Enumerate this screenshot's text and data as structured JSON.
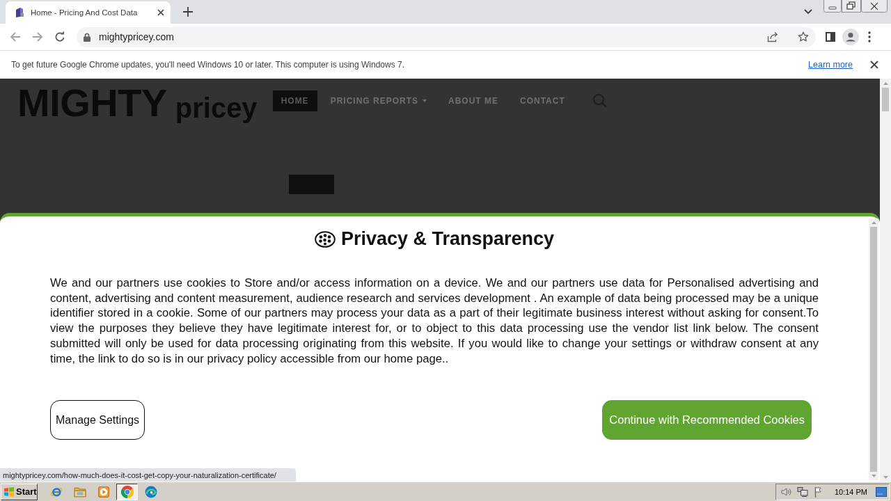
{
  "browser": {
    "tabs": [
      {
        "title": "Home - Pricing And Cost Data",
        "selected": true
      }
    ],
    "address": "mightypricey.com"
  },
  "update_bar": {
    "message": "To get future Google Chrome updates, you'll need Windows 10 or later. This computer is using Windows 7.",
    "link": "Learn more"
  },
  "site_header": {
    "logo": {
      "main": "MIGHTY",
      "sub": "pricey"
    },
    "nav": [
      {
        "label": "HOME",
        "selected": true,
        "submenu": false
      },
      {
        "label": "PRICING REPORTS",
        "selected": false,
        "submenu": true
      },
      {
        "label": "ABOUT ME",
        "selected": false,
        "submenu": false
      },
      {
        "label": "CONTACT",
        "selected": false,
        "submenu": false
      }
    ]
  },
  "consent_dialog": {
    "title": "Privacy & Transparency",
    "body": "We and our partners use cookies to Store and/or access information on a device. We and our partners use data for Personalised advertising and content, advertising and content measurement, audience research and services development . An example of data being processed may be a unique identifier stored in a cookie. Some of our partners may process your data as a part of their legitimate business interest without asking for consent.To view the purposes they believe they have legitimate interest for, or to object to this data processing use the vendor list link below. The consent submitted will only be used for data processing originating from this website. If you would like to change your settings or withdraw consent at any time, the link to do so is in our privacy policy accessible from our home page..",
    "buttons": [
      {
        "label": "Manage Settings",
        "kind": "outline"
      },
      {
        "label": "Continue with Recommended Cookies",
        "kind": "primary"
      }
    ]
  },
  "status_bubble": "mightypricey.com/how-much-does-it-cost-get-copy-your-naturalization-certificate/",
  "taskbar": {
    "start": "Start",
    "apps": [
      {
        "kind": "ie",
        "selected": false
      },
      {
        "kind": "folder",
        "selected": false
      },
      {
        "kind": "media",
        "selected": false
      },
      {
        "kind": "chrome",
        "selected": true
      },
      {
        "kind": "edge",
        "selected": false
      }
    ],
    "clock": "10:14 PM"
  }
}
